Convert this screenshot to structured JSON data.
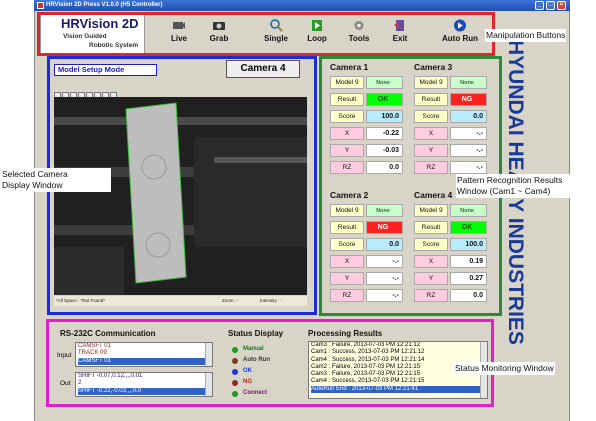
{
  "window": {
    "title": "HRVision 2D Press V1.0.0 (H5 Controller)",
    "min_icon": "minimize-icon",
    "max_icon": "maximize-icon",
    "close_icon": "close-icon"
  },
  "logo": {
    "title": "HRVision 2D",
    "line1": "Vision Guided",
    "line2": "Robotic System"
  },
  "toolbar": {
    "live": "Live",
    "grab": "Grab",
    "single": "Single",
    "loop": "Loop",
    "tools": "Tools",
    "exit": "Exit",
    "autorun": "Auto Run"
  },
  "annotations": {
    "manipulation": "Manipulation Buttons",
    "camera_display": "Selected Camera\nDisplay Window",
    "pattern": "Pattern Recognition Results\nWindow (Cam1 ~ Cam4)",
    "status_monitor": "Status Monitoring Window"
  },
  "view": {
    "mode": "Model Setup Mode",
    "selected_camera": "Camera 4",
    "status_left": "*All Space : *Not Found*",
    "status_zoom": "Zoom : -",
    "status_intensity": "Intensity : -"
  },
  "cameras": [
    {
      "title": "Camera 1",
      "model": "Model 9",
      "model_value": "None",
      "result": "OK",
      "result_color": "#00ff00",
      "score": "100.0",
      "x": "-0.22",
      "y": "-0.03",
      "rz": "0.0"
    },
    {
      "title": "Camera 3",
      "model": "Model 9",
      "model_value": "None",
      "result": "NG",
      "result_color": "#ff2020",
      "score": "0.0",
      "x": "-.-",
      "y": "-.-",
      "rz": "-.-"
    },
    {
      "title": "Camera 2",
      "model": "Model 9",
      "model_value": "None",
      "result": "NG",
      "result_color": "#ff2020",
      "score": "0.0",
      "x": "-.-",
      "y": "-.-",
      "rz": "-.-"
    },
    {
      "title": "Camera 4",
      "model": "Model 9",
      "model_value": "None",
      "result": "OK",
      "result_color": "#00ff00",
      "score": "100.0",
      "x": "0.19",
      "y": "0.27",
      "rz": "0.0"
    }
  ],
  "row_labels": {
    "result": "Result",
    "score": "Score",
    "x": "X",
    "y": "Y",
    "rz": "RZ"
  },
  "brand_text": "HYUNDAI HEAVY INDUSTRIES",
  "rs232": {
    "title": "RS-232C Communication",
    "input_label": "Input",
    "out_label": "Out",
    "input_lines": [
      "CAMSFT 01",
      "TRACK 09",
      "CAMSFT 01"
    ],
    "out_lines": [
      "SHIFT -0.07,0.12,,,,0.01",
      "2",
      "SHIFT -0.22,-0.03,,,,0.0"
    ]
  },
  "status_display": {
    "title": "Status Display",
    "items": [
      {
        "label": "Manual",
        "color": "#1a9a1a",
        "text_color": "#1a7a1a"
      },
      {
        "label": "Auto Run",
        "color": "#704020",
        "text_color": "#333333"
      },
      {
        "label": "OK",
        "color": "#1a3ad0",
        "text_color": "#1a3ad0"
      },
      {
        "label": "NG",
        "color": "#8a2a2a",
        "text_color": "#c02020"
      },
      {
        "label": "Connect",
        "color": "#1a9a1a",
        "text_color": "#7a1a6a"
      }
    ]
  },
  "processing": {
    "title": "Processing Results",
    "lines": [
      "Cam3 : Failure, 2013-07-03 PM 12:21:12",
      "Cam1 : Success, 2013-07-03 PM 12:21:12",
      "Cam4 : Success, 2013-07-03 PM 12:21:14",
      "Cam2 : Failure, 2013-07-03 PM 12:21:15",
      "Cam3 : Failure, 2013-07-03 PM 12:21:15",
      "Cam4 : Success, 2013-07-03 PM 12:21:15",
      "AutoRun End : 2013-07-03 PM 12:21:41"
    ]
  },
  "colors": {
    "manip_box": "#e8212a",
    "camera_box": "#1b2bd6",
    "pattern_box": "#2a8a3a",
    "status_box": "#e020c8",
    "label_yellow": "#ffffc8",
    "label_pink": "#ffcce0",
    "score_cyan": "#b8ecff",
    "model_none": "#c8ffc8"
  }
}
